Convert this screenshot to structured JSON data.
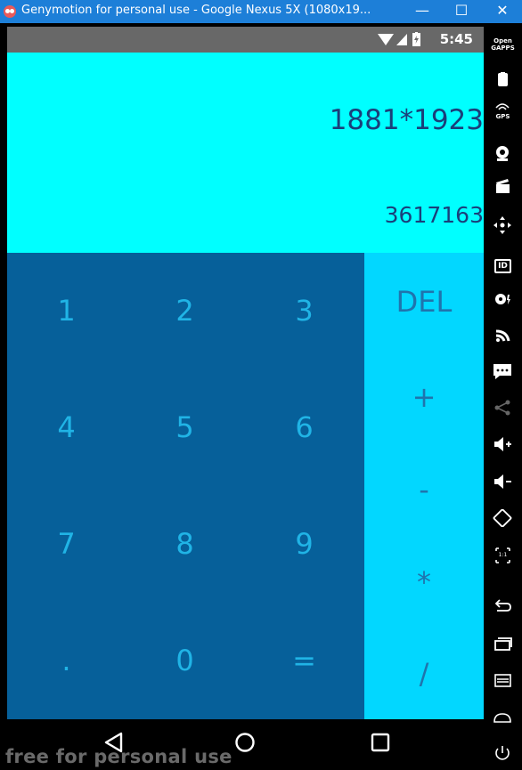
{
  "window": {
    "title": "Genymotion for personal use - Google Nexus 5X (1080x19...",
    "minimize": "—",
    "maximize": "☐",
    "close": "✕"
  },
  "statusbar": {
    "time": "5:45"
  },
  "display": {
    "expression": "1881*1923",
    "result": "3617163"
  },
  "keys": [
    {
      "label": "1"
    },
    {
      "label": "2"
    },
    {
      "label": "3"
    },
    {
      "label": "4"
    },
    {
      "label": "5"
    },
    {
      "label": "6"
    },
    {
      "label": "7"
    },
    {
      "label": "8"
    },
    {
      "label": "9"
    },
    {
      "label": "."
    },
    {
      "label": "0"
    },
    {
      "label": "="
    }
  ],
  "operators": {
    "del": "DEL",
    "plus": "+",
    "minus": "-",
    "multiply": "*",
    "divide": "/"
  },
  "watermark": "free for personal use",
  "sidebar": {
    "opengapps_line1": "Open",
    "opengapps_line2": "GAPPS",
    "gps": "GPS",
    "id": "ID",
    "pixel_perfect": "1:1"
  },
  "colors": {
    "titlebar": "#1d7fd8",
    "display": "#00ffff",
    "keypad": "#06609a",
    "operators": "#02d7ff",
    "key_text": "#20b4e6",
    "display_text": "#1a3f7a"
  }
}
